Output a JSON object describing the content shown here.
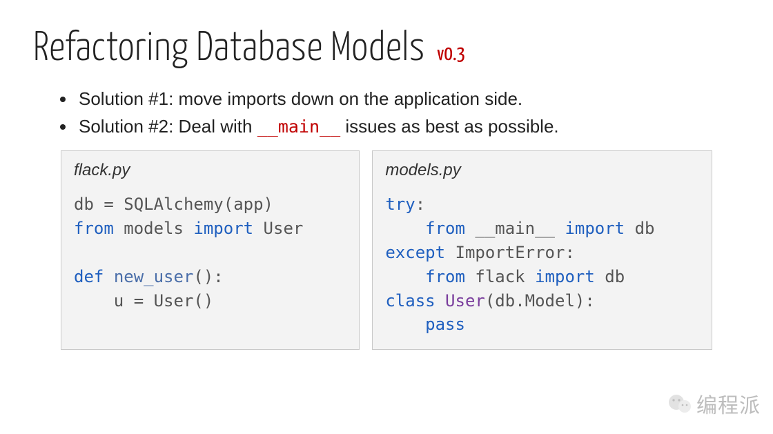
{
  "title": "Refactoring Database Models",
  "version": "v0.3",
  "bullets": [
    {
      "prefix": "Solution #1: move imports down on the application side.",
      "code": ""
    },
    {
      "prefix": "Solution #2: Deal with ",
      "code": "__main__",
      "suffix": " issues as best as possible."
    }
  ],
  "left": {
    "filename": "flack.py",
    "code": {
      "l1a": "db = SQLAlchemy(app)",
      "l2a": "from",
      "l2b": " models ",
      "l2c": "import",
      "l2d": " User",
      "blank": "",
      "l4a": "def",
      "l4b": " ",
      "l4c": "new_user",
      "l4d": "():",
      "l5a": "    u = User()"
    }
  },
  "right": {
    "filename": "models.py",
    "code": {
      "l1a": "try",
      "l1b": ":",
      "l2a": "    ",
      "l2b": "from",
      "l2c": " __main__ ",
      "l2d": "import",
      "l2e": " db",
      "l3a": "except",
      "l3b": " ImportError:",
      "l4a": "    ",
      "l4b": "from",
      "l4c": " flack ",
      "l4d": "import",
      "l4e": " db",
      "l5a": "class",
      "l5b": " ",
      "l5c": "User",
      "l5d": "(db.Model):",
      "l6a": "    ",
      "l6b": "pass"
    }
  },
  "watermark": "编程派"
}
